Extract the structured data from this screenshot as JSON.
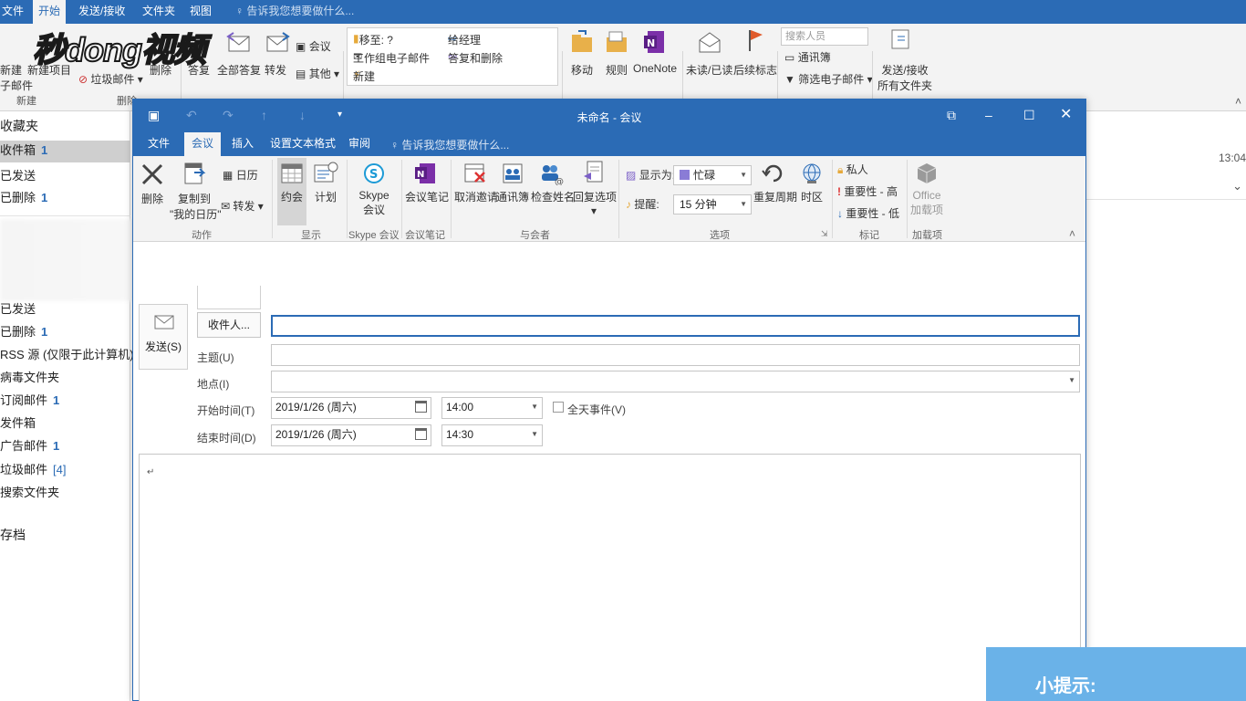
{
  "bg": {
    "tabs": [
      "文件",
      "开始",
      "发送/接收",
      "文件夹",
      "视图"
    ],
    "tell_me": "告诉我您想要做什么...",
    "ribbon": {
      "new_email_lines": [
        "新建",
        "子邮件"
      ],
      "new_item": "新建项目",
      "delete": "删除",
      "junk": "垃圾邮件",
      "reply": "答复",
      "reply_all": "全部答复",
      "forward": "转发",
      "meeting": "会议",
      "other": "其他",
      "qs": [
        "移至: ?",
        "给经理",
        "工作组电子邮件",
        "答复和删除",
        "新建"
      ],
      "move": "移动",
      "rules": "规则",
      "onenote": "OneNote",
      "unread_read": "未读/已读",
      "followup": "后续标志",
      "search_people": "搜索人员",
      "address_book": "通讯簿",
      "filter_email": "筛选电子邮件",
      "send_receive_lines": [
        "发送/接收",
        "所有文件夹"
      ],
      "group_new": "新建",
      "group_delete": "删除"
    },
    "logo": "秒dong视频",
    "time": "13:04"
  },
  "nav": {
    "favorites": "收藏夹",
    "items_top": [
      {
        "label": "收件箱",
        "count": "1"
      },
      {
        "label": "已发送",
        "count": ""
      },
      {
        "label": "已删除",
        "count": "1"
      }
    ],
    "items": [
      {
        "label": "已发送",
        "count": ""
      },
      {
        "label": "已删除",
        "count": "1"
      },
      {
        "label": "RSS 源 (仅限于此计算机)",
        "count": ""
      },
      {
        "label": "病毒文件夹",
        "count": ""
      },
      {
        "label": "订阅邮件",
        "count": "1"
      },
      {
        "label": "发件箱",
        "count": ""
      },
      {
        "label": "广告邮件",
        "count": "1"
      },
      {
        "label": "垃圾邮件",
        "count": "[4]"
      },
      {
        "label": "搜索文件夹",
        "count": ""
      }
    ],
    "archive": "存档"
  },
  "win": {
    "title": "未命名 - 会议",
    "tabs": [
      "文件",
      "会议",
      "插入",
      "设置文本格式",
      "审阅"
    ],
    "tell_me": "告诉我您想要做什么...",
    "ribbon": {
      "delete": "删除",
      "copy_to_lines": [
        "复制到",
        "\"我的日历\""
      ],
      "calendar": "日历",
      "forward": "转发",
      "appointment": "约会",
      "schedule": "计划",
      "skype_lines": [
        "Skype",
        "会议"
      ],
      "meeting_notes": "会议笔记",
      "cancel_invite": "取消邀请",
      "address_book": "通讯簿",
      "check_names": "检查姓名",
      "response_options": "回复选项",
      "show_as_label": "显示为:",
      "show_as_value": "忙碌",
      "reminder_label": "提醒:",
      "reminder_value": "15 分钟",
      "recurrence": "重复周期",
      "time_zones": "时区",
      "private": "私人",
      "importance_high": "重要性 - 高",
      "importance_low": "重要性 - 低",
      "office_addins_lines": [
        "Office",
        "加载项"
      ],
      "groups": {
        "actions": "动作",
        "show": "显示",
        "skype": "Skype 会议",
        "notes": "会议笔记",
        "attendees": "与会者",
        "options": "选项",
        "tags": "标记",
        "addins": "加载项"
      }
    },
    "form": {
      "send": "发送(S)",
      "to_button": "收件人...",
      "to_value": "",
      "subject_label": "主题(U)",
      "subject_value": "",
      "location_label": "地点(I)",
      "location_value": "",
      "start_label": "开始时间(T)",
      "start_date": "2019/1/26 (周六)",
      "start_time": "14:00",
      "all_day": "全天事件(V)",
      "end_label": "结束时间(D)",
      "end_date": "2019/1/26 (周六)",
      "end_time": "14:30",
      "body_mark": "↵"
    }
  },
  "hint": "小提示:",
  "colors": {
    "accent": "#2b6bb5",
    "ribbon": "#f3f3f3",
    "hint": "#6ab2e8"
  }
}
